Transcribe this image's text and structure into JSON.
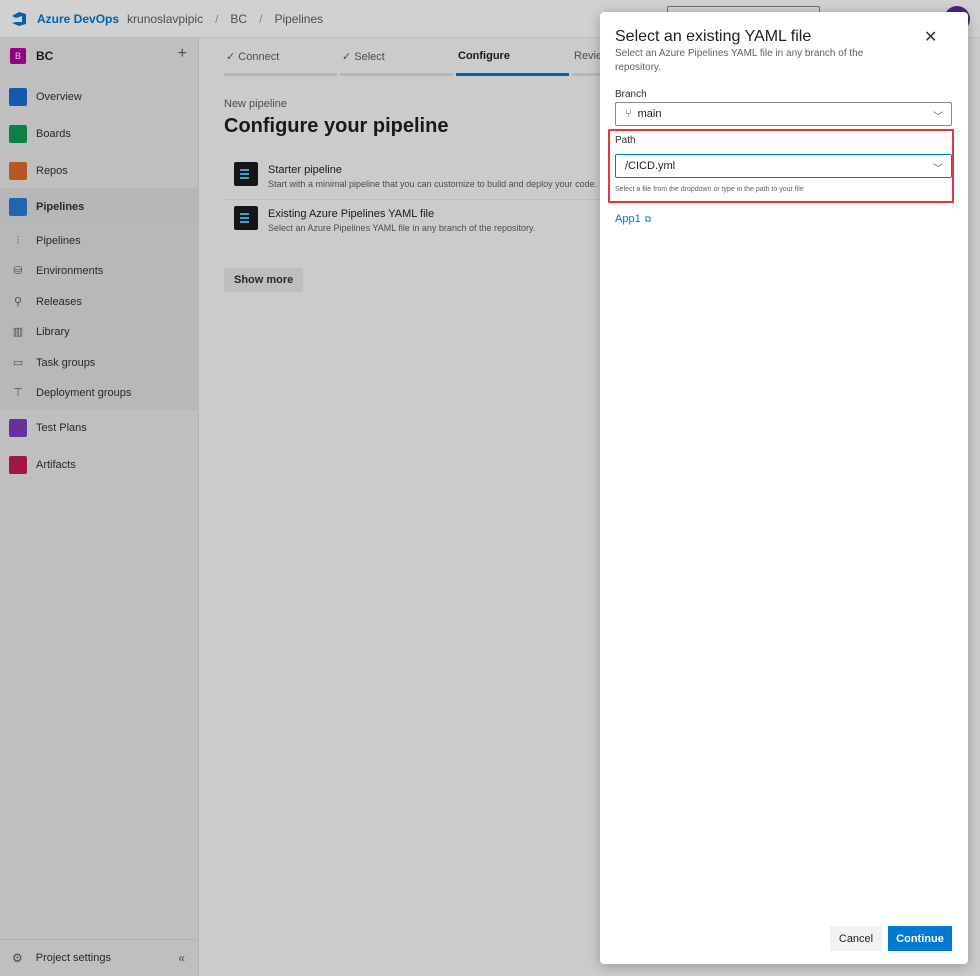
{
  "topbar": {
    "brand": "Azure DevOps",
    "breadcrumbs": [
      "krunoslavpipic",
      "BC",
      "Pipelines"
    ]
  },
  "sidebar": {
    "project_badge": "B",
    "project_name": "BC",
    "items": [
      {
        "label": "Overview",
        "icon": "overview-icon",
        "color": "#1e6ad8"
      },
      {
        "label": "Boards",
        "icon": "boards-icon",
        "color": "#109d58"
      },
      {
        "label": "Repos",
        "icon": "repos-icon",
        "color": "#e06c2c"
      },
      {
        "label": "Pipelines",
        "icon": "pipelines-icon",
        "color": "#2b79d8"
      }
    ],
    "sub_items": [
      {
        "label": "Pipelines",
        "icon": "pipelines-sub-icon"
      },
      {
        "label": "Environments",
        "icon": "environments-icon"
      },
      {
        "label": "Releases",
        "icon": "releases-icon"
      },
      {
        "label": "Library",
        "icon": "library-icon"
      },
      {
        "label": "Task groups",
        "icon": "task-groups-icon"
      },
      {
        "label": "Deployment groups",
        "icon": "deployment-groups-icon"
      }
    ],
    "bottom_items": [
      {
        "label": "Test Plans",
        "icon": "test-plans-icon",
        "color": "#7e3bbf"
      },
      {
        "label": "Artifacts",
        "icon": "artifacts-icon",
        "color": "#c21d58"
      }
    ],
    "project_settings": "Project settings"
  },
  "main": {
    "steps": [
      "Connect",
      "Select",
      "Configure",
      "Review"
    ],
    "active_step": "Configure",
    "new_pipeline": "New pipeline",
    "title": "Configure your pipeline",
    "options": [
      {
        "title": "Starter pipeline",
        "desc": "Start with a minimal pipeline that you can customize to build and deploy your code."
      },
      {
        "title": "Existing Azure Pipelines YAML file",
        "desc": "Select an Azure Pipelines YAML file in any branch of the repository."
      }
    ],
    "show_more": "Show more"
  },
  "dialog": {
    "title": "Select an existing YAML file",
    "subtitle": "Select an Azure Pipelines YAML file in any branch of the repository.",
    "branch_label": "Branch",
    "branch_value": "main",
    "path_label": "Path",
    "path_value": "/CICD.yml",
    "path_helper": "Select a file from the dropdown or type in the path to your file",
    "link_text": "App1",
    "cancel": "Cancel",
    "continue": "Continue"
  },
  "colors": {
    "accent": "#0078d4",
    "highlight": "#e53935"
  }
}
